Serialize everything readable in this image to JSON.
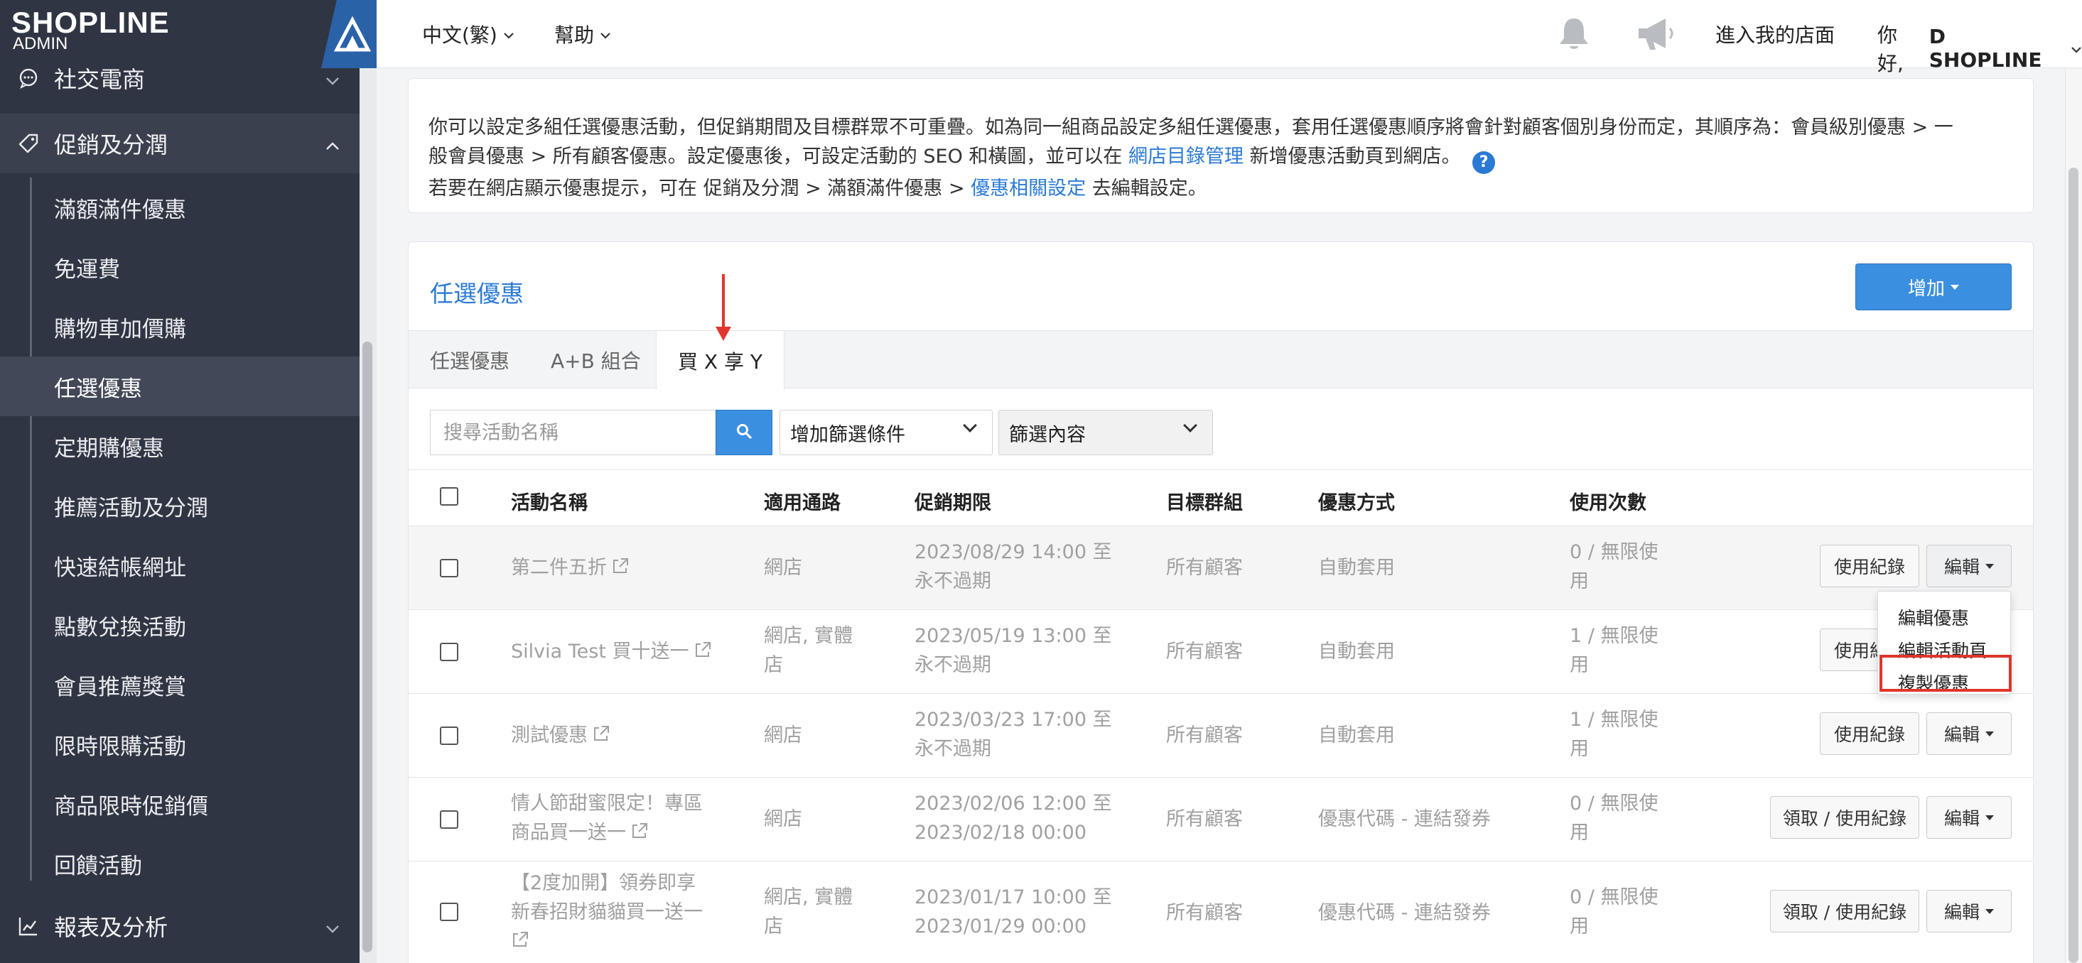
{
  "brand": {
    "name": "SHOPLINE",
    "sub": "ADMIN"
  },
  "sidebar": {
    "sections": [
      {
        "label": "社交電商",
        "icon": "chat-bubble-icon"
      },
      {
        "label": "促銷及分潤",
        "icon": "tag-icon"
      },
      {
        "label": "報表及分析",
        "icon": "chart-icon"
      }
    ],
    "items": [
      {
        "label": "滿額滿件優惠"
      },
      {
        "label": "免運費"
      },
      {
        "label": "購物車加價購"
      },
      {
        "label": "任選優惠"
      },
      {
        "label": "定期購優惠"
      },
      {
        "label": "推薦活動及分潤"
      },
      {
        "label": "快速結帳網址"
      },
      {
        "label": "點數兌換活動"
      },
      {
        "label": "會員推薦獎賞"
      },
      {
        "label": "限時限購活動"
      },
      {
        "label": "商品限時促銷價"
      },
      {
        "label": "回饋活動"
      }
    ]
  },
  "topbar": {
    "language": "中文(繁)",
    "help": "幫助",
    "store_link": "進入我的店面",
    "greeting": "你好,",
    "user": "D SHOPLINE"
  },
  "notice": {
    "line1": "你可以設定多組任選優惠活動，但促銷期間及目標群眾不可重疊。如為同一組商品設定多組任選優惠，套用任選優惠順序將會針對顧客個別身份而定，其順序為：會員級別優惠 > 一",
    "line2_a": "般會員優惠 > 所有顧客優惠。設定優惠後，可設定活動的 SEO 和橫圖，並可以在",
    "line2_link": "網店目錄管理",
    "line2_b": "新增優惠活動頁到網店。",
    "line3_a": "若要在網店顯示優惠提示，可在 促銷及分潤 > 滿額滿件優惠 >",
    "line3_link": "優惠相關設定",
    "line3_b": "去編輯設定。"
  },
  "panel": {
    "title": "任選優惠",
    "add_label": "增加",
    "tabs": [
      {
        "label": "任選優惠"
      },
      {
        "label": "A+B 組合"
      },
      {
        "label": "買 X 享 Y"
      }
    ],
    "search_placeholder": "搜尋活動名稱",
    "filter_select": "增加篩選條件",
    "filter_content": "篩選內容"
  },
  "table": {
    "headers": [
      "活動名稱",
      "適用通路",
      "促銷期限",
      "目標群組",
      "優惠方式",
      "使用次數"
    ],
    "rows": [
      {
        "name1": "第二件五折",
        "name2": "",
        "channel1": "網店",
        "channel2": "",
        "period1": "2023/08/29 14:00 至",
        "period2": "永不過期",
        "target": "所有顧客",
        "method": "自動套用",
        "usage1": "0 / 無限使",
        "usage2": "用",
        "record": "使用紀錄",
        "edit": "編輯"
      },
      {
        "name1": "Silvia Test 買十送一",
        "name2": "",
        "channel1": "網店, 實體",
        "channel2": "店",
        "period1": "2023/05/19 13:00 至",
        "period2": "永不過期",
        "target": "所有顧客",
        "method": "自動套用",
        "usage1": "1 / 無限使",
        "usage2": "用",
        "record": "使用紀錄",
        "edit": "編輯"
      },
      {
        "name1": "測試優惠",
        "name2": "",
        "channel1": "網店",
        "channel2": "",
        "period1": "2023/03/23 17:00 至",
        "period2": "永不過期",
        "target": "所有顧客",
        "method": "自動套用",
        "usage1": "1 / 無限使",
        "usage2": "用",
        "record": "使用紀錄",
        "edit": "編輯"
      },
      {
        "name1": "情人節甜蜜限定！專區",
        "name2": "商品買一送一",
        "channel1": "網店",
        "channel2": "",
        "period1": "2023/02/06 12:00 至",
        "period2": "2023/02/18 00:00",
        "target": "所有顧客",
        "method": "優惠代碼 - 連結發券",
        "usage1": "0 / 無限使",
        "usage2": "用",
        "record": "領取 / 使用紀錄",
        "edit": "編輯"
      },
      {
        "name1": "【2度加開】領券即享",
        "name2": "新春招財貓貓買一送一",
        "channel1": "網店, 實體",
        "channel2": "店",
        "period1": "2023/01/17 10:00 至",
        "period2": "2023/01/29 00:00",
        "target": "所有顧客",
        "method": "優惠代碼 - 連結發券",
        "usage1": "0 / 無限使",
        "usage2": "用",
        "record": "領取 / 使用紀錄",
        "edit": "編輯"
      }
    ]
  },
  "dropdown": {
    "items": [
      "編輯優惠",
      "編輯活動頁",
      "複製優惠"
    ]
  },
  "colors": {
    "accent": "#2a7ad5",
    "sidebar": "#2f3542",
    "highlight": "#e0362c"
  }
}
